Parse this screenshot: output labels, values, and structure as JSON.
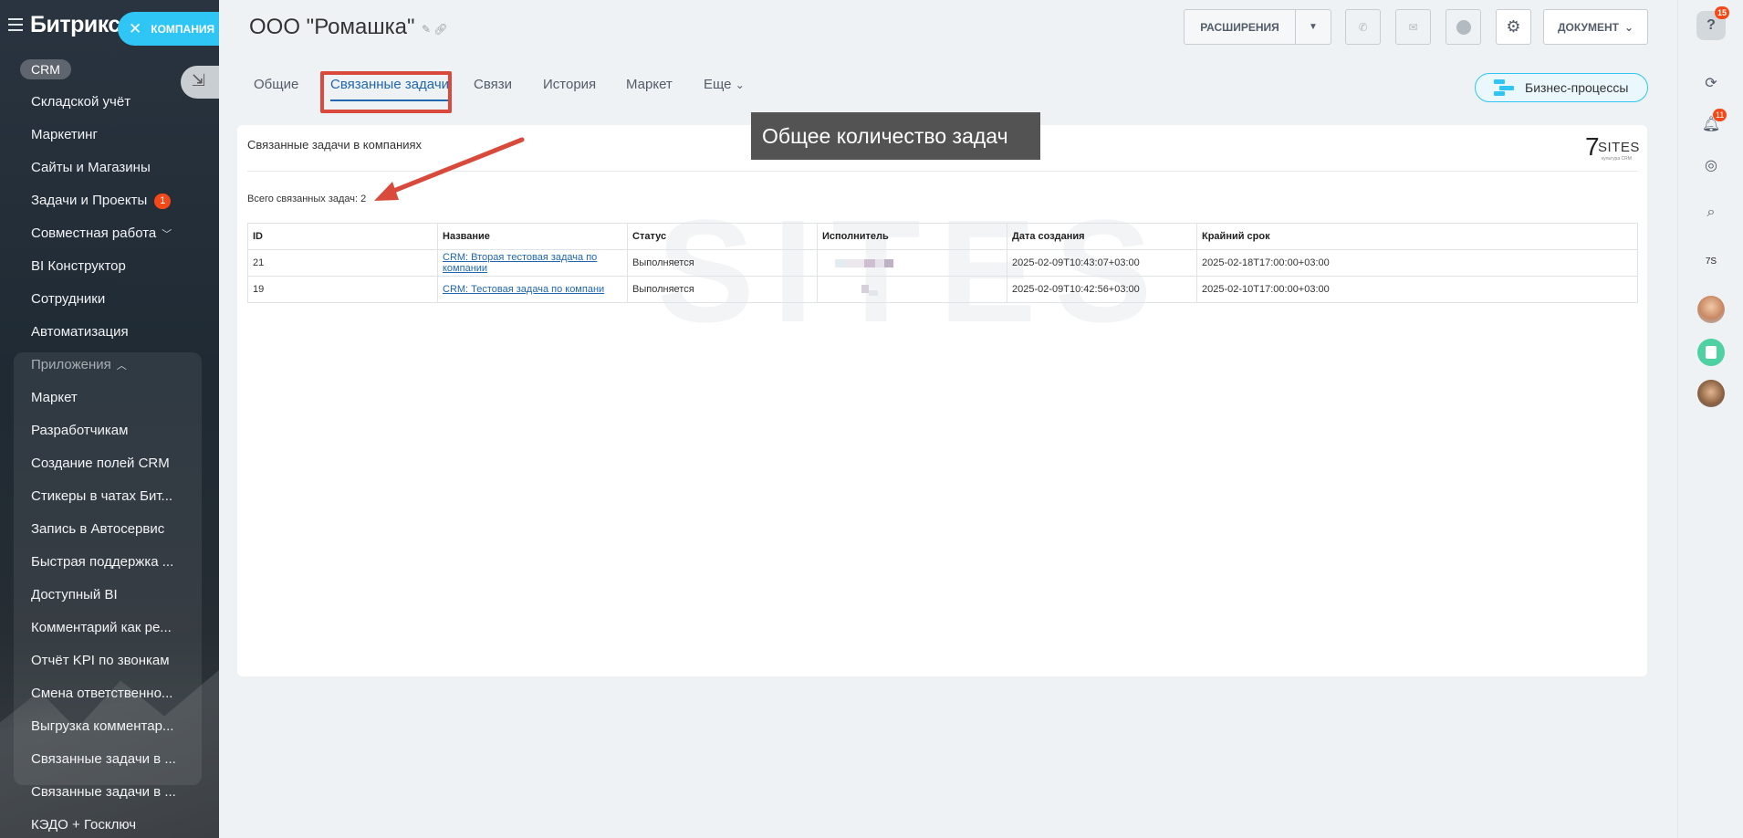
{
  "sidebar": {
    "logo": "Битрикс",
    "company_pill": "КОМПАНИЯ",
    "crm_badge": "CRM",
    "items": [
      {
        "label": "Складской учёт"
      },
      {
        "label": "Маркетинг"
      },
      {
        "label": "Сайты и Магазины"
      },
      {
        "label": "Задачи и Проекты",
        "counter": "1"
      },
      {
        "label": "Совместная работа"
      },
      {
        "label": "BI Конструктор"
      },
      {
        "label": "Сотрудники"
      },
      {
        "label": "Автоматизация"
      }
    ],
    "apps_header": "Приложения",
    "apps": [
      {
        "label": "Маркет"
      },
      {
        "label": "Разработчикам"
      },
      {
        "label": "Создание полей CRM"
      },
      {
        "label": "Стикеры в чатах Бит..."
      },
      {
        "label": "Запись в Автосервис"
      },
      {
        "label": "Быстрая поддержка ..."
      },
      {
        "label": "Доступный BI"
      },
      {
        "label": "Комментарий как ре..."
      },
      {
        "label": "Отчёт KPI по звонкам"
      },
      {
        "label": "Смена ответственно..."
      },
      {
        "label": "Выгрузка комментар..."
      },
      {
        "label": "Связанные задачи в ..."
      },
      {
        "label": "Связанные задачи в ..."
      },
      {
        "label": "КЭДО + Госключ"
      }
    ]
  },
  "header": {
    "title": "ООО \"Ромашка\"",
    "extensions_label": "РАСШИРЕНИЯ",
    "document_label": "ДОКУМЕНТ"
  },
  "tabs": [
    {
      "label": "Общие"
    },
    {
      "label": "Связанные задачи"
    },
    {
      "label": "Связи"
    },
    {
      "label": "История"
    },
    {
      "label": "Маркет"
    },
    {
      "label": "Еще"
    }
  ],
  "bp_button": "Бизнес-процессы",
  "card": {
    "title": "Связанные задачи в компаниях",
    "total_label": "Всего связанных задач: 2",
    "logo_text": "SITES",
    "logo_seven": "7",
    "logo_sub": "культура CRM",
    "columns": [
      "ID",
      "Название",
      "Статус",
      "Исполнитель",
      "Дата создания",
      "Крайний срок"
    ],
    "rows": [
      {
        "id": "21",
        "name": "CRM: Вторая тестовая задача по компании",
        "status": "Выполняется",
        "created": "2025-02-09T10:43:07+03:00",
        "deadline": "2025-02-18T17:00:00+03:00"
      },
      {
        "id": "19",
        "name": "CRM: Тестовая задача по компани",
        "status": "Выполняется",
        "created": "2025-02-09T10:42:56+03:00",
        "deadline": "2025-02-10T17:00:00+03:00"
      }
    ]
  },
  "annotation": {
    "callout": "Общее количество задач",
    "color": "#d94a3c"
  },
  "rightbar": {
    "help_badge": "15",
    "notify_badge": "11"
  },
  "colors": {
    "accent": "#2fc6f6",
    "link": "#2067b0",
    "counter": "#f54819"
  }
}
